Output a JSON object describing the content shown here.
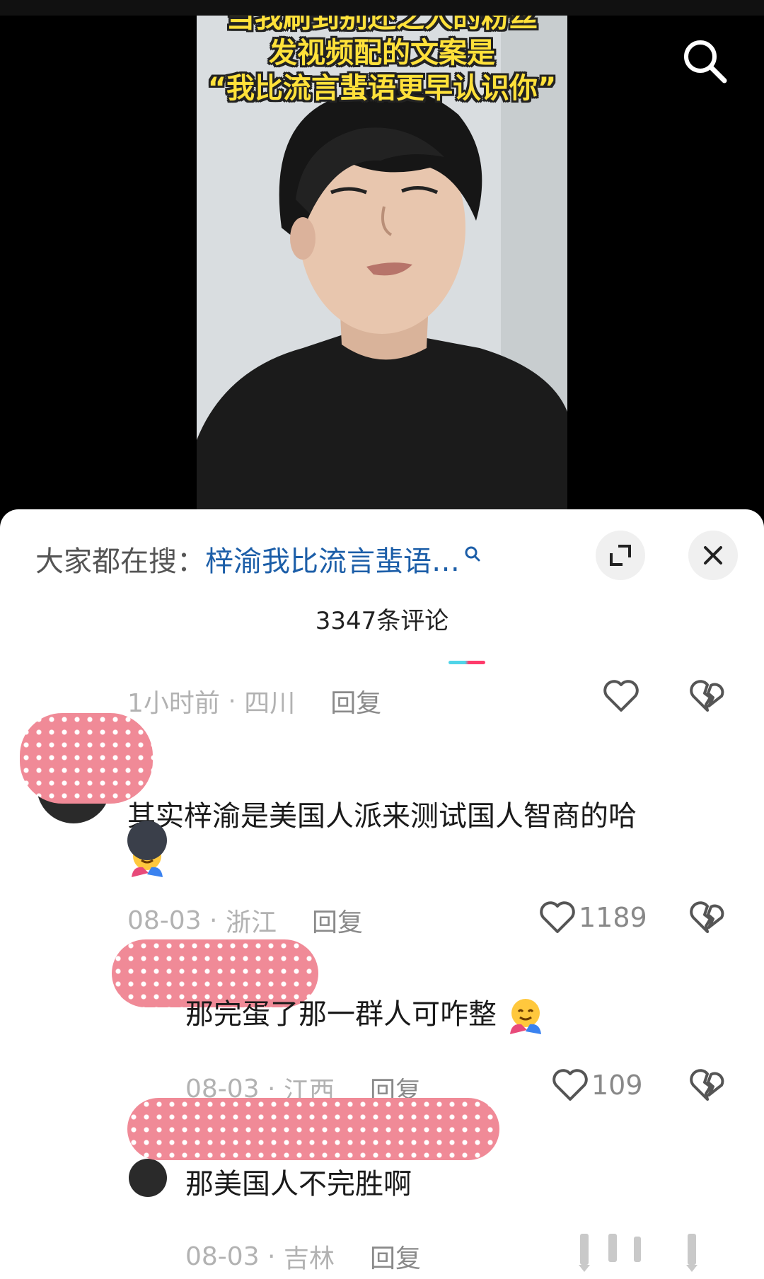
{
  "video": {
    "caption_lines": [
      "当我刷到别还之人的粉丝",
      "发视频配的文案是",
      "“我比流言蜚语更早认识你”"
    ],
    "search_icon": "search-icon"
  },
  "sheet": {
    "search_prefix": "大家都在搜：",
    "search_query": "梓渝我比流言蜚语…",
    "comment_count": "3347条评论"
  },
  "comments": [
    {
      "time": "1小时前",
      "region": "四川",
      "reply": "回复",
      "likes": ""
    },
    {
      "text": "其实梓渝是美国人派来测试国人智商的哈",
      "time": "08-03",
      "region": "浙江",
      "reply": "回复",
      "likes": "1189"
    },
    {
      "text": "那完蛋了那一群人可咋整",
      "time": "08-03",
      "region": "江西",
      "reply": "回复",
      "likes": "109"
    },
    {
      "text": "那美国人不完胜啊",
      "time": "08-03",
      "region": "吉林",
      "reply": "回复"
    }
  ],
  "colors": {
    "accent_link": "#1c5ea8",
    "caption_yellow": "#ffe13a",
    "redact_pink": "#f08a97"
  }
}
